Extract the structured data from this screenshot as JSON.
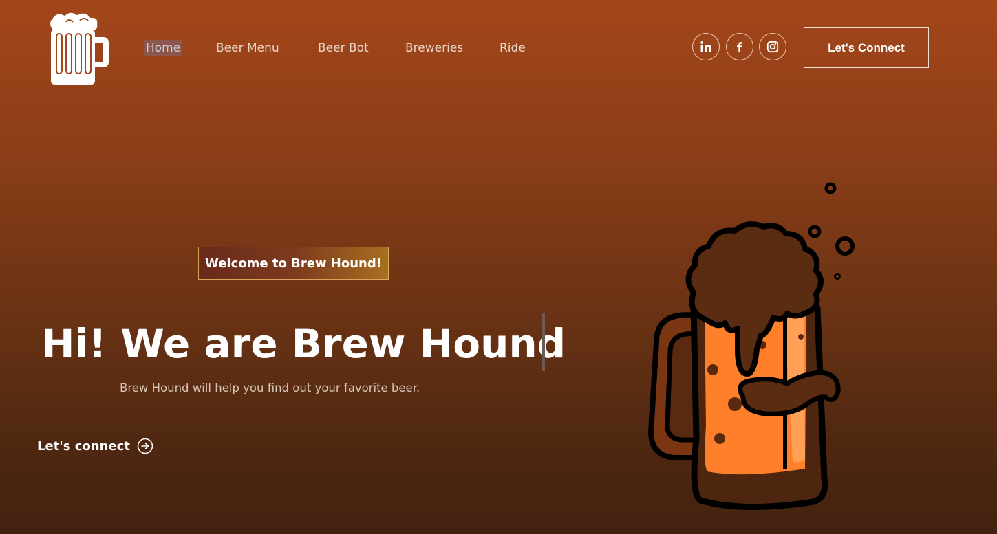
{
  "nav": {
    "items": [
      {
        "label": "Home",
        "active": true
      },
      {
        "label": "Beer Menu",
        "active": false
      },
      {
        "label": "Beer Bot",
        "active": false
      },
      {
        "label": "Breweries",
        "active": false
      },
      {
        "label": "Ride",
        "active": false
      }
    ]
  },
  "social": {
    "icons": [
      "linkedin-icon",
      "facebook-icon",
      "instagram-icon"
    ]
  },
  "header": {
    "connect_label": "Let's Connect"
  },
  "hero": {
    "badge": "Welcome to Brew Hound!",
    "headline": "Hi! We are Brew Hound",
    "subtext": "Brew Hound will help you find out your favorite beer.",
    "cta_label": "Let's connect"
  },
  "colors": {
    "background_top": "#a4461a",
    "background_bottom": "#42220f",
    "beer": "#ff7f2a",
    "foam": "#5a2c12",
    "badge_border": "#d9a55a"
  }
}
